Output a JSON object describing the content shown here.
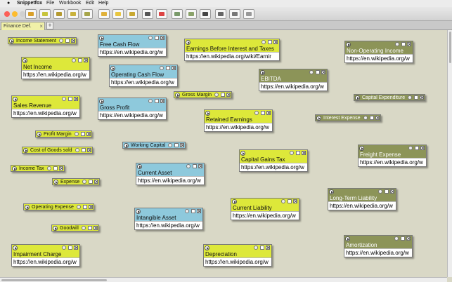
{
  "menubar": {
    "app": "Snippetfox",
    "items": [
      "File",
      "Workbook",
      "Edit",
      "Help"
    ]
  },
  "colors": {
    "lime": "#dde83a",
    "blue": "#8ec9dc",
    "olive": "#8c9458",
    "canvas": "#d9d8c6"
  },
  "toolbar": {
    "icons": [
      "new-snippet-icon",
      "new-note-icon",
      "new-link-icon",
      "new-tag-icon",
      "new-group-icon",
      "import-icon",
      "export-icon",
      "stamp-icon",
      "browse-icon",
      "image-icon",
      "text-icon",
      "layout-icon",
      "frame-icon",
      "zoom-icon",
      "print-icon"
    ]
  },
  "tab": {
    "label": "Finance Def.",
    "close": "×",
    "add": "+"
  },
  "cards": [
    {
      "title": "Net Income",
      "url": "https://en.wikipedia.org/w"
    },
    {
      "title": "Free Cash Flow",
      "url": "https://en.wikipedia.org/w"
    },
    {
      "title": "Operating Cash Flow",
      "url": "https://en.wikipedia.org/w"
    },
    {
      "title": "Earnings Before Interest and Taxes",
      "url": "https://en.wikipedia.org/wiki/Earnir"
    },
    {
      "title": "Non-Operating Income",
      "url": "https://en.wikipedia.org/w"
    },
    {
      "title": "EBITDA",
      "url": "https://en.wikipedia.org/w"
    },
    {
      "title": "Sales Revenue",
      "url": "https://en.wikipedia.org/w"
    },
    {
      "title": "Gross Profit",
      "url": "https://en.wikipedia.org/w"
    },
    {
      "title": "Retained Earnings",
      "url": "https://en.wikipedia.org/w"
    },
    {
      "title": "Capital Gains Tax",
      "url": "https://en.wikipedia.org/w"
    },
    {
      "title": "Freight Expense",
      "url": "https://en.wikipedia.org/w"
    },
    {
      "title": "Current Asset",
      "url": "https://en.wikipedia.org/w"
    },
    {
      "title": "Long-Term Liability",
      "url": "https://en.wikipedia.org/w"
    },
    {
      "title": "Current Liability",
      "url": "https://en.wikipedia.org/w"
    },
    {
      "title": "Intangible Asset",
      "url": "https://en.wikipedia.org/w"
    },
    {
      "title": "Impairment Charge",
      "url": "https://en.wikipedia.org/w"
    },
    {
      "title": "Depreciation",
      "url": "https://en.wikipedia.org/w"
    },
    {
      "title": "Amortization",
      "url": "https://en.wikipedia.org/w"
    }
  ],
  "tags": [
    {
      "label": "Income Statement"
    },
    {
      "label": "Gross Margin"
    },
    {
      "label": "Capital Expenditure"
    },
    {
      "label": "Interest Expense"
    },
    {
      "label": "Profit Margin"
    },
    {
      "label": "Cost of Goods sold"
    },
    {
      "label": "Working Capital"
    },
    {
      "label": "Income Tax"
    },
    {
      "label": "Expense"
    },
    {
      "label": "Operating Expense"
    },
    {
      "label": "Goodwill"
    }
  ]
}
